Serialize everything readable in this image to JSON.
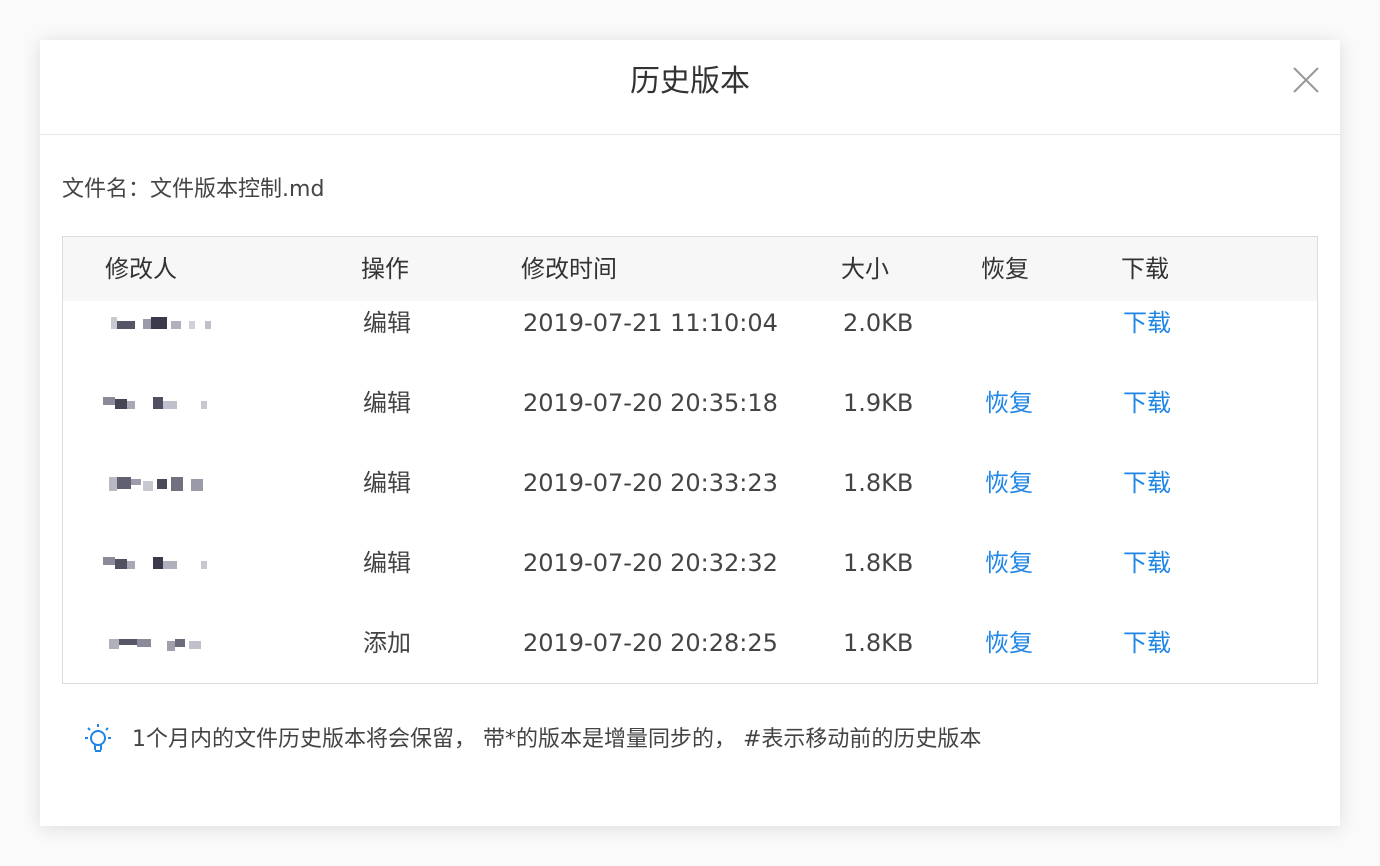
{
  "dialog": {
    "title": "历史版本",
    "close_icon": "close-icon"
  },
  "file": {
    "label": "文件名：",
    "name": "文件版本控制.md"
  },
  "table": {
    "columns": [
      "修改人",
      "操作",
      "修改时间",
      "大小",
      "恢复",
      "下载"
    ],
    "rows": [
      {
        "modifier": "",
        "action": "编辑",
        "time": "2019-07-21 11:10:04",
        "size": "2.0KB",
        "restore": "",
        "download": "下载"
      },
      {
        "modifier": "",
        "action": "编辑",
        "time": "2019-07-20 20:35:18",
        "size": "1.9KB",
        "restore": "恢复",
        "download": "下载"
      },
      {
        "modifier": "",
        "action": "编辑",
        "time": "2019-07-20 20:33:23",
        "size": "1.8KB",
        "restore": "恢复",
        "download": "下载"
      },
      {
        "modifier": "",
        "action": "编辑",
        "time": "2019-07-20 20:32:32",
        "size": "1.8KB",
        "restore": "恢复",
        "download": "下载"
      },
      {
        "modifier": "",
        "action": "添加",
        "time": "2019-07-20 20:28:25",
        "size": "1.8KB",
        "restore": "恢复",
        "download": "下载"
      }
    ]
  },
  "tip": {
    "icon": "lightbulb-icon",
    "text": "1个月内的文件历史版本将会保留， 带*的版本是增量同步的， #表示移动前的历史版本"
  },
  "colors": {
    "link": "#1f86e6",
    "text": "#444444",
    "header_bg": "#f7f7f7"
  }
}
